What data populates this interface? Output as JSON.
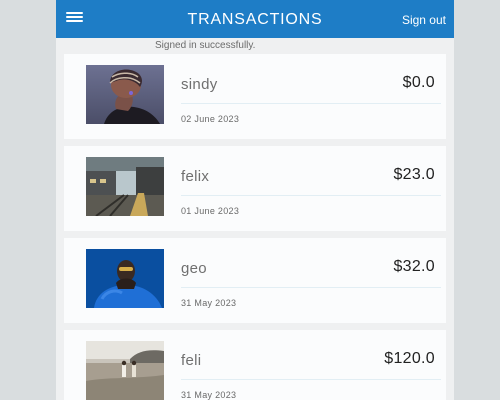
{
  "appbar": {
    "title": "TRANSACTIONS",
    "signout_label": "Sign out",
    "menu_icon": "menu-icon",
    "color": "#1e7dc6"
  },
  "status": {
    "message": "Signed in successfully."
  },
  "transactions": [
    {
      "name": "sindy",
      "amount": "$0.0",
      "date": "02 June 2023",
      "image": "portrait-profile-photo"
    },
    {
      "name": "felix",
      "amount": "$23.0",
      "date": "01 June 2023",
      "image": "train-station-photo"
    },
    {
      "name": "geo",
      "amount": "$32.0",
      "date": "31 May 2023",
      "image": "person-blue-background-photo"
    },
    {
      "name": "feli",
      "amount": "$120.0",
      "date": "31 May 2023",
      "image": "couple-field-photo"
    }
  ]
}
